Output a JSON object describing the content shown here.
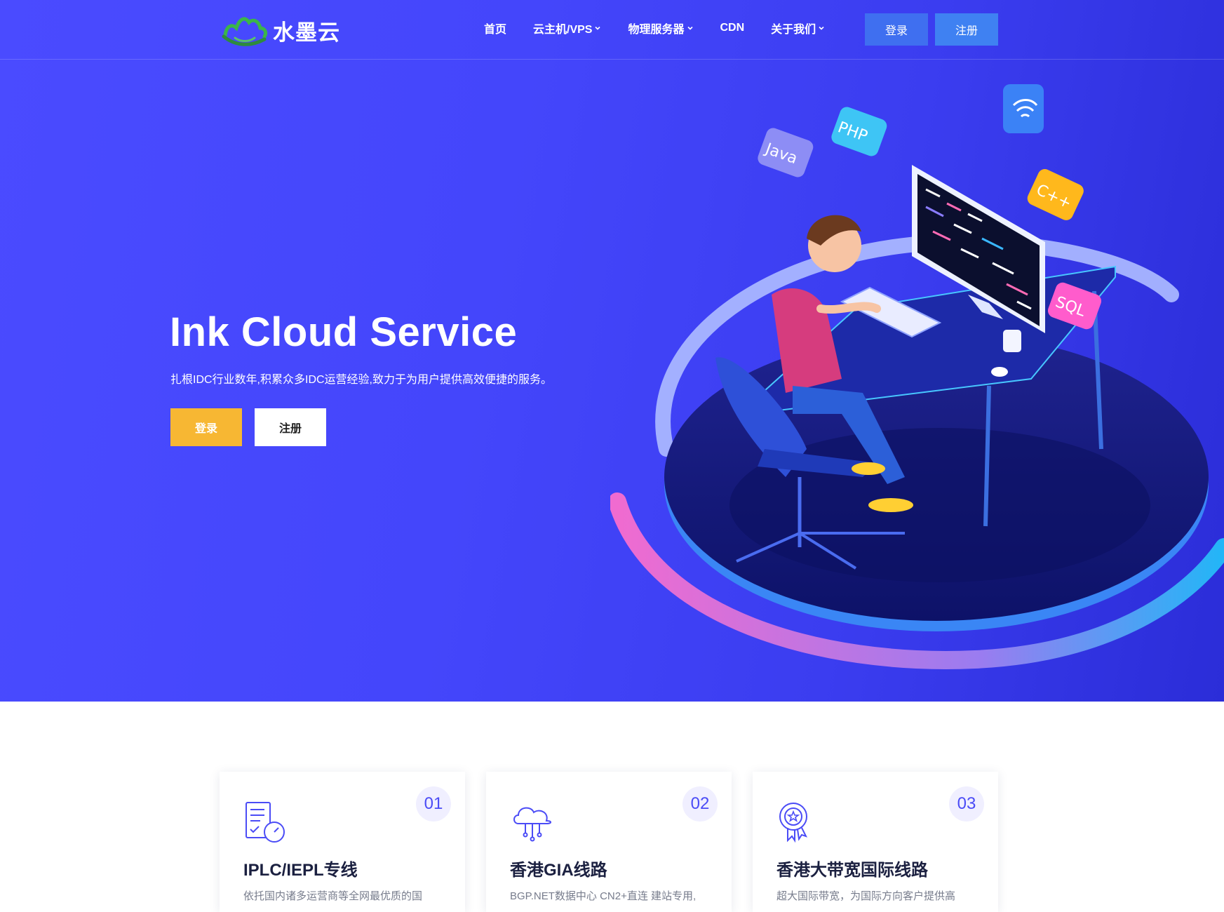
{
  "brand": {
    "name": "水墨云"
  },
  "nav": {
    "items": [
      {
        "label": "首页",
        "dropdown": false
      },
      {
        "label": "云主机/VPS",
        "dropdown": true
      },
      {
        "label": "物理服务器",
        "dropdown": true
      },
      {
        "label": "CDN",
        "dropdown": false
      },
      {
        "label": "关于我们",
        "dropdown": true
      }
    ],
    "login_label": "登录",
    "register_label": "注册"
  },
  "hero": {
    "title": "Ink Cloud Service",
    "subtitle": "扎根IDC行业数年,积累众多IDC运营经验,致力于为用户提供高效便捷的服务。",
    "login_label": "登录",
    "register_label": "注册",
    "illustration_tags": [
      "Java",
      "PHP",
      "C++",
      "SQL"
    ]
  },
  "features": [
    {
      "number": "01",
      "icon": "document-stopwatch-icon",
      "title": "IPLC/IEPL专线",
      "desc": "依托国内诸多运营商等全网最优质的国"
    },
    {
      "number": "02",
      "icon": "cloud-network-icon",
      "title": "香港GIA线路",
      "desc": "BGP.NET数据中心 CN2+直连 建站专用,"
    },
    {
      "number": "03",
      "icon": "award-badge-icon",
      "title": "香港大带宽国际线路",
      "desc": "超大国际带宽，为国际方向客户提供高"
    }
  ],
  "colors": {
    "hero_bg": "#4446fb",
    "accent_yellow": "#f7b733",
    "top_button": "#3f7cf0",
    "number_text": "#4b4cf6"
  }
}
